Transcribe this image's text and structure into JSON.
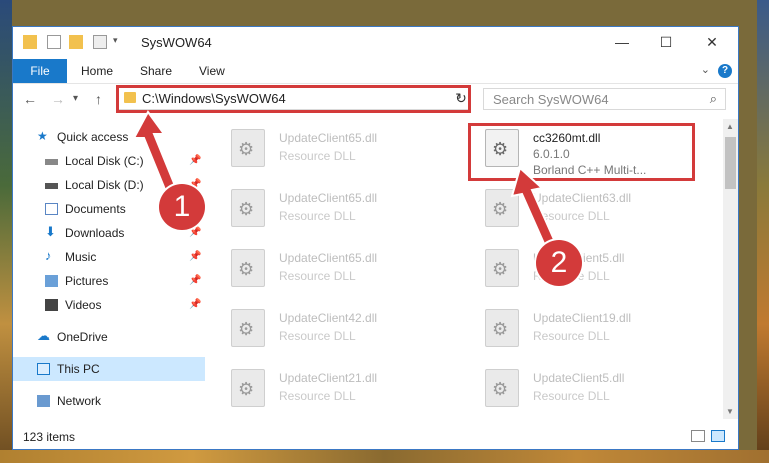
{
  "window": {
    "title": "SysWOW64",
    "minimize": "—",
    "maximize": "☐",
    "close": "✕"
  },
  "ribbon": {
    "file": "File",
    "tabs": [
      "Home",
      "Share",
      "View"
    ],
    "help": "?"
  },
  "nav": {
    "back": "←",
    "forward": "→",
    "recent": "▾",
    "up": "↑",
    "address": "C:\\Windows\\SysWOW64",
    "refresh": "↻",
    "search_placeholder": "Search SysWOW64"
  },
  "sidebar": {
    "items": [
      {
        "label": "Quick access",
        "icon": "star-icon",
        "pinned": false
      },
      {
        "label": "Local Disk (C:)",
        "icon": "drive-icon",
        "pinned": true
      },
      {
        "label": "Local Disk (D:)",
        "icon": "drive-icon",
        "pinned": true
      },
      {
        "label": "Documents",
        "icon": "documents-icon",
        "pinned": true
      },
      {
        "label": "Downloads",
        "icon": "download-icon",
        "pinned": true
      },
      {
        "label": "Music",
        "icon": "music-icon",
        "pinned": true
      },
      {
        "label": "Pictures",
        "icon": "pictures-icon",
        "pinned": true
      },
      {
        "label": "Videos",
        "icon": "videos-icon",
        "pinned": true
      },
      {
        "label": "OneDrive",
        "icon": "cloud-icon",
        "pinned": false
      },
      {
        "label": "This PC",
        "icon": "computer-icon",
        "pinned": false
      },
      {
        "label": "Network",
        "icon": "network-icon",
        "pinned": false
      }
    ]
  },
  "files": {
    "left_column": [
      {
        "name": "UpdateClient65.dll",
        "desc": "Resource DLL"
      },
      {
        "name": "UpdateClient65.dll",
        "desc": "Resource DLL"
      },
      {
        "name": "UpdateClient65.dll",
        "desc": "Resource DLL"
      },
      {
        "name": "UpdateClient42.dll",
        "desc": "Resource DLL"
      },
      {
        "name": "UpdateClient21.dll",
        "desc": "Resource DLL"
      }
    ],
    "right_column": [
      {
        "name": "cc3260mt.dll",
        "desc": "6.0.1.0",
        "desc2": "Borland C++ Multi-t...",
        "selected": true
      },
      {
        "name": "UpdateClient63.dll",
        "desc": "Resource DLL"
      },
      {
        "name": "UpdateClient5.dll",
        "desc": "Resource DLL"
      },
      {
        "name": "UpdateClient19.dll",
        "desc": "Resource DLL"
      },
      {
        "name": "UpdateClient5.dll",
        "desc": "Resource DLL"
      }
    ]
  },
  "status": {
    "count": "123 items"
  },
  "markers": {
    "one": "1",
    "two": "2"
  },
  "colors": {
    "accent": "#1979ca",
    "annotation": "#d33a3a",
    "selection": "#cce8ff"
  }
}
